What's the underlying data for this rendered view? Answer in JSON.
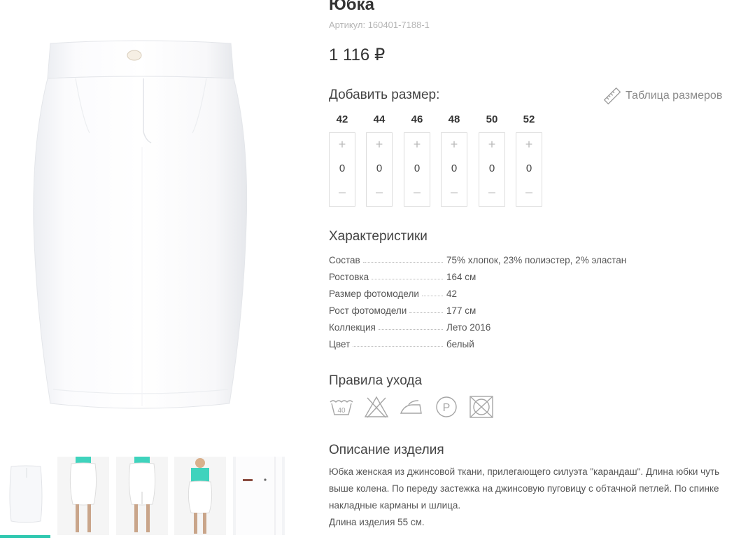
{
  "product": {
    "title": "Юбка",
    "sku": "Артикул: 160401-7188-1",
    "price": "1 116 ₽"
  },
  "sizes": {
    "heading": "Добавить размер:",
    "table_link": "Таблица размеров",
    "plus": "+",
    "minus": "–",
    "items": [
      {
        "size": "42",
        "qty": "0"
      },
      {
        "size": "44",
        "qty": "0"
      },
      {
        "size": "46",
        "qty": "0"
      },
      {
        "size": "48",
        "qty": "0"
      },
      {
        "size": "50",
        "qty": "0"
      },
      {
        "size": "52",
        "qty": "0"
      }
    ]
  },
  "characteristics": {
    "heading": "Характеристики",
    "rows": [
      {
        "key": "Состав",
        "value": "75% хлопок, 23% полиэстер, 2% эластан"
      },
      {
        "key": "Ростовка",
        "value": "164 см"
      },
      {
        "key": "Размер фотомодели",
        "value": "42"
      },
      {
        "key": "Рост фотомодели",
        "value": "177 см"
      },
      {
        "key": "Коллекция",
        "value": "Лето 2016"
      },
      {
        "key": "Цвет",
        "value": "белый"
      }
    ]
  },
  "care": {
    "heading": "Правила ухода",
    "icons": [
      "wash-40-icon",
      "no-bleach-icon",
      "iron-icon",
      "professional-clean-p-icon",
      "no-tumble-dry-icon"
    ],
    "wash_temp": "40",
    "dryclean_letter": "P"
  },
  "description": {
    "heading": "Описание изделия",
    "text1": "Юбка женская из джинсовой ткани, прилегающего силуэта \"карандаш\". Длина юбки чуть выше колена. По переду застежка на джинсовую пуговицу с обтачной петлей. По спинке накладные карманы и шлица.",
    "text2": "Длина изделия 55 см."
  },
  "colors": {
    "accent": "#30c8b0",
    "top_color": "#3fd3bd"
  }
}
